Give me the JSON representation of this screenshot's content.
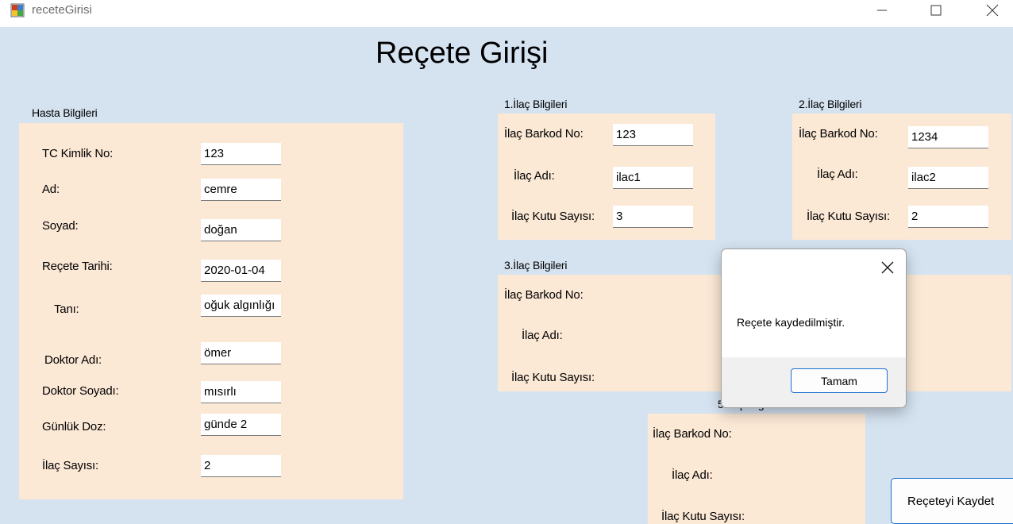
{
  "window": {
    "title": "receteGirisi"
  },
  "form": {
    "title": "Reçete Girişi"
  },
  "patient": {
    "group_label": "Hasta Bilgileri",
    "fields": [
      {
        "label": "TC Kimlik No:",
        "value": "123"
      },
      {
        "label": "Ad:",
        "value": "cemre"
      },
      {
        "label": "Soyad:",
        "value": "doğan"
      },
      {
        "label": "Reçete Tarihi:",
        "value": "2020-01-04"
      },
      {
        "label": "Tanı:",
        "value": "oğuk algınlığı"
      },
      {
        "label": "Doktor Adı:",
        "value": "ömer"
      },
      {
        "label": "Doktor Soyadı:",
        "value": "mısırlı"
      },
      {
        "label": "Günlük Doz:",
        "value": "günde 2"
      },
      {
        "label": "İlaç Sayısı:",
        "value": "2"
      }
    ]
  },
  "drug1": {
    "group_label": "1.İlaç Bilgileri",
    "barcode_label": "İlaç Barkod No:",
    "barcode_value": "123",
    "name_label": "İlaç Adı:",
    "name_value": "ilac1",
    "box_label": "İlaç Kutu Sayısı:",
    "box_value": "3"
  },
  "drug2": {
    "group_label": "2.İlaç Bilgileri",
    "barcode_label": "İlaç Barkod No:",
    "barcode_value": "1234",
    "name_label": "İlaç Adı:",
    "name_value": "ilac2",
    "box_label": "İlaç Kutu Sayısı:",
    "box_value": "2"
  },
  "drug3": {
    "group_label": "3.İlaç Bilgileri",
    "barcode_label": "İlaç Barkod No:",
    "name_label": "İlaç Adı:",
    "box_label": "İlaç Kutu Sayısı:"
  },
  "drug5": {
    "group_label": "5.İlaç Bilgileri",
    "barcode_label": "İlaç Barkod No:",
    "name_label": "İlaç Adı:",
    "box_label": "İlaç Kutu Sayısı:"
  },
  "dialog": {
    "message": "Reçete kaydedilmiştir.",
    "ok_label": "Tamam"
  },
  "actions": {
    "save_label": "Reçeteyi Kaydet"
  },
  "colors": {
    "form_background": "#d5e3f1",
    "panel_background": "#fbe8d5",
    "button_accent": "#1b6fd1"
  }
}
